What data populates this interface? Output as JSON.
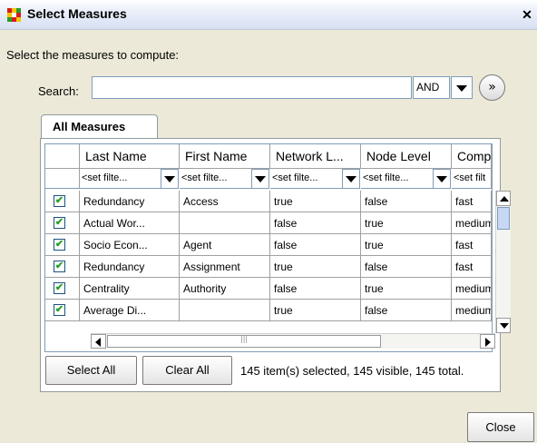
{
  "window": {
    "title": "Select Measures",
    "close_glyph": "✕"
  },
  "prompt": "Select the measures to compute:",
  "search": {
    "label": "Search:",
    "value": "",
    "operator": "AND"
  },
  "tabs": [
    {
      "label": "All Measures"
    }
  ],
  "table": {
    "columns": [
      "Last Name",
      "First Name",
      "Network L...",
      "Node Level",
      "Comp"
    ],
    "filter_placeholder": "<set filte...",
    "filter_placeholder_short": "<set filt",
    "rows": [
      {
        "checked": true,
        "cells": [
          "Redundancy",
          "Access",
          "true",
          "false",
          "fast"
        ]
      },
      {
        "checked": true,
        "cells": [
          "Actual Wor...",
          "",
          "false",
          "true",
          "medium"
        ]
      },
      {
        "checked": true,
        "cells": [
          "Socio Econ...",
          "Agent",
          "false",
          "true",
          "fast"
        ]
      },
      {
        "checked": true,
        "cells": [
          "Redundancy",
          "Assignment",
          "true",
          "false",
          "fast"
        ]
      },
      {
        "checked": true,
        "cells": [
          "Centrality",
          "Authority",
          "false",
          "true",
          "medium"
        ]
      },
      {
        "checked": true,
        "cells": [
          "Average Di...",
          "",
          "true",
          "false",
          "medium"
        ]
      }
    ]
  },
  "buttons": {
    "select_all": "Select All",
    "clear_all": "Clear All",
    "close": "Close"
  },
  "status": "145 item(s) selected, 145 visible, 145 total.",
  "colors": {
    "app_icon": [
      "#d81c1c",
      "#f2c500",
      "#2a9a2a",
      "#f2c500",
      "#ffffff",
      "#d81c1c",
      "#2a9a2a",
      "#d81c1c",
      "#f2c500"
    ]
  }
}
